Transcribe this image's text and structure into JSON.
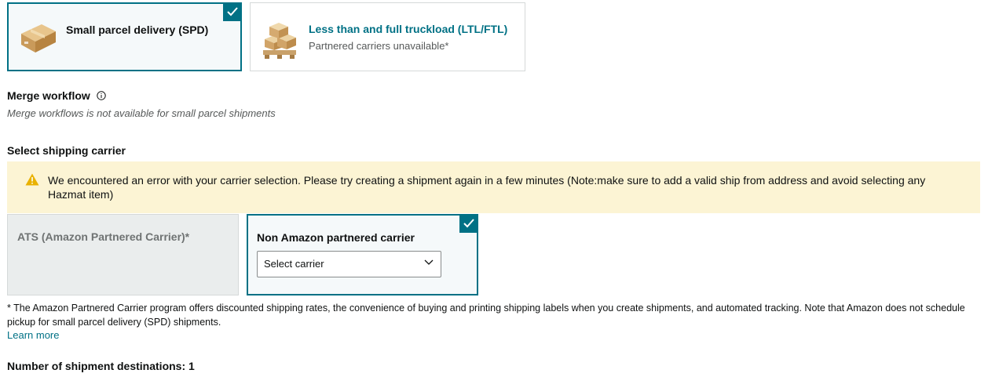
{
  "shipping_modes": {
    "spd": {
      "title": "Small parcel delivery (SPD)",
      "selected": true
    },
    "ltl": {
      "title": "Less than and full truckload (LTL/FTL)",
      "subtitle": "Partnered carriers unavailable*",
      "selected": false
    }
  },
  "merge_workflow": {
    "label": "Merge workflow",
    "note": "Merge workflows is not available for small parcel shipments"
  },
  "carrier_section": {
    "label": "Select shipping carrier",
    "alert_text": "We encountered an error with your carrier selection. Please try creating a shipment again in a few minutes (Note:make sure to add a valid ship from address and avoid selecting any Hazmat item)",
    "ats_title": "ATS (Amazon Partnered Carrier)*",
    "non_title": "Non Amazon partnered carrier",
    "select_placeholder": "Select carrier"
  },
  "footnote": "* The Amazon Partnered Carrier program offers discounted shipping rates, the convenience of buying and printing shipping labels when you create shipments, and automated tracking. Note that Amazon does not schedule pickup for small parcel delivery (SPD) shipments.",
  "learn_more": "Learn more",
  "destinations_label": "Number of shipment destinations: 1",
  "colors": {
    "accent": "#007185",
    "alert_bg": "#fcf4d4",
    "warning": "#e9b100"
  }
}
